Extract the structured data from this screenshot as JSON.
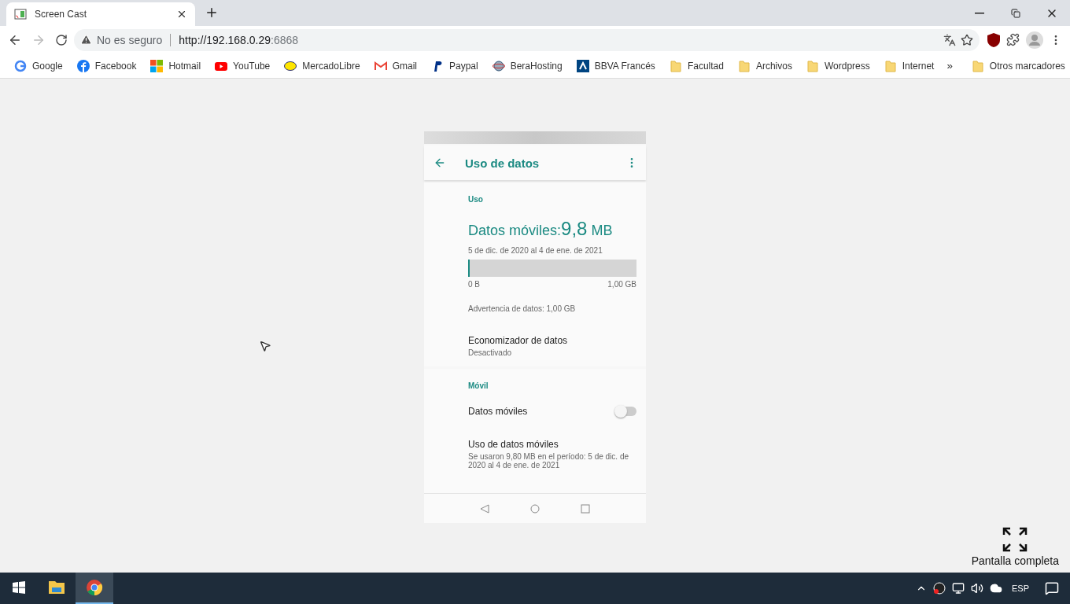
{
  "tab": {
    "title": "Screen Cast"
  },
  "address": {
    "security": "No es seguro",
    "url_host": "http://192.168.0.29",
    "url_port": ":6868"
  },
  "bookmarks": [
    {
      "label": "Google",
      "kind": "google"
    },
    {
      "label": "Facebook",
      "kind": "facebook"
    },
    {
      "label": "Hotmail",
      "kind": "windows"
    },
    {
      "label": "YouTube",
      "kind": "youtube"
    },
    {
      "label": "MercadoLibre",
      "kind": "mercado"
    },
    {
      "label": "Gmail",
      "kind": "gmail"
    },
    {
      "label": "Paypal",
      "kind": "paypal"
    },
    {
      "label": "BeraHosting",
      "kind": "globe"
    },
    {
      "label": "BBVA Francés",
      "kind": "bbva"
    },
    {
      "label": "Facultad",
      "kind": "folder"
    },
    {
      "label": "Archivos",
      "kind": "folder"
    },
    {
      "label": "Wordpress",
      "kind": "folder"
    },
    {
      "label": "Internet",
      "kind": "folder"
    }
  ],
  "bookmarks_more": "»",
  "other_bookmarks": "Otros marcadores",
  "phone": {
    "title": "Uso de datos",
    "usage_header": "Uso",
    "usage_label": "Datos móviles: ",
    "usage_value": "9,8",
    "usage_unit": "MB",
    "period": "5 de dic. de 2020 al 4 de ene. de 2021",
    "bar": {
      "level": 0.01,
      "min": "0 B",
      "max": "1,00 GB"
    },
    "warning": "Advertencia de datos: 1,00 GB",
    "saver": {
      "title": "Economizador de datos",
      "subtitle": "Desactivado"
    },
    "mobile_header": "Móvil",
    "mobile_data": {
      "title": "Datos móviles",
      "on": false
    },
    "mobile_usage": {
      "title": "Uso de datos móviles",
      "subtitle": "Se usaron 9,80 MB en el período: 5 de dic. de 2020 al 4 de ene. de 2021"
    }
  },
  "fullscreen": {
    "label": "Pantalla completa"
  },
  "taskbar": {
    "apps": [
      {
        "kind": "explorer",
        "selected": false
      },
      {
        "kind": "chrome",
        "selected": true
      }
    ],
    "language": "ESP"
  }
}
